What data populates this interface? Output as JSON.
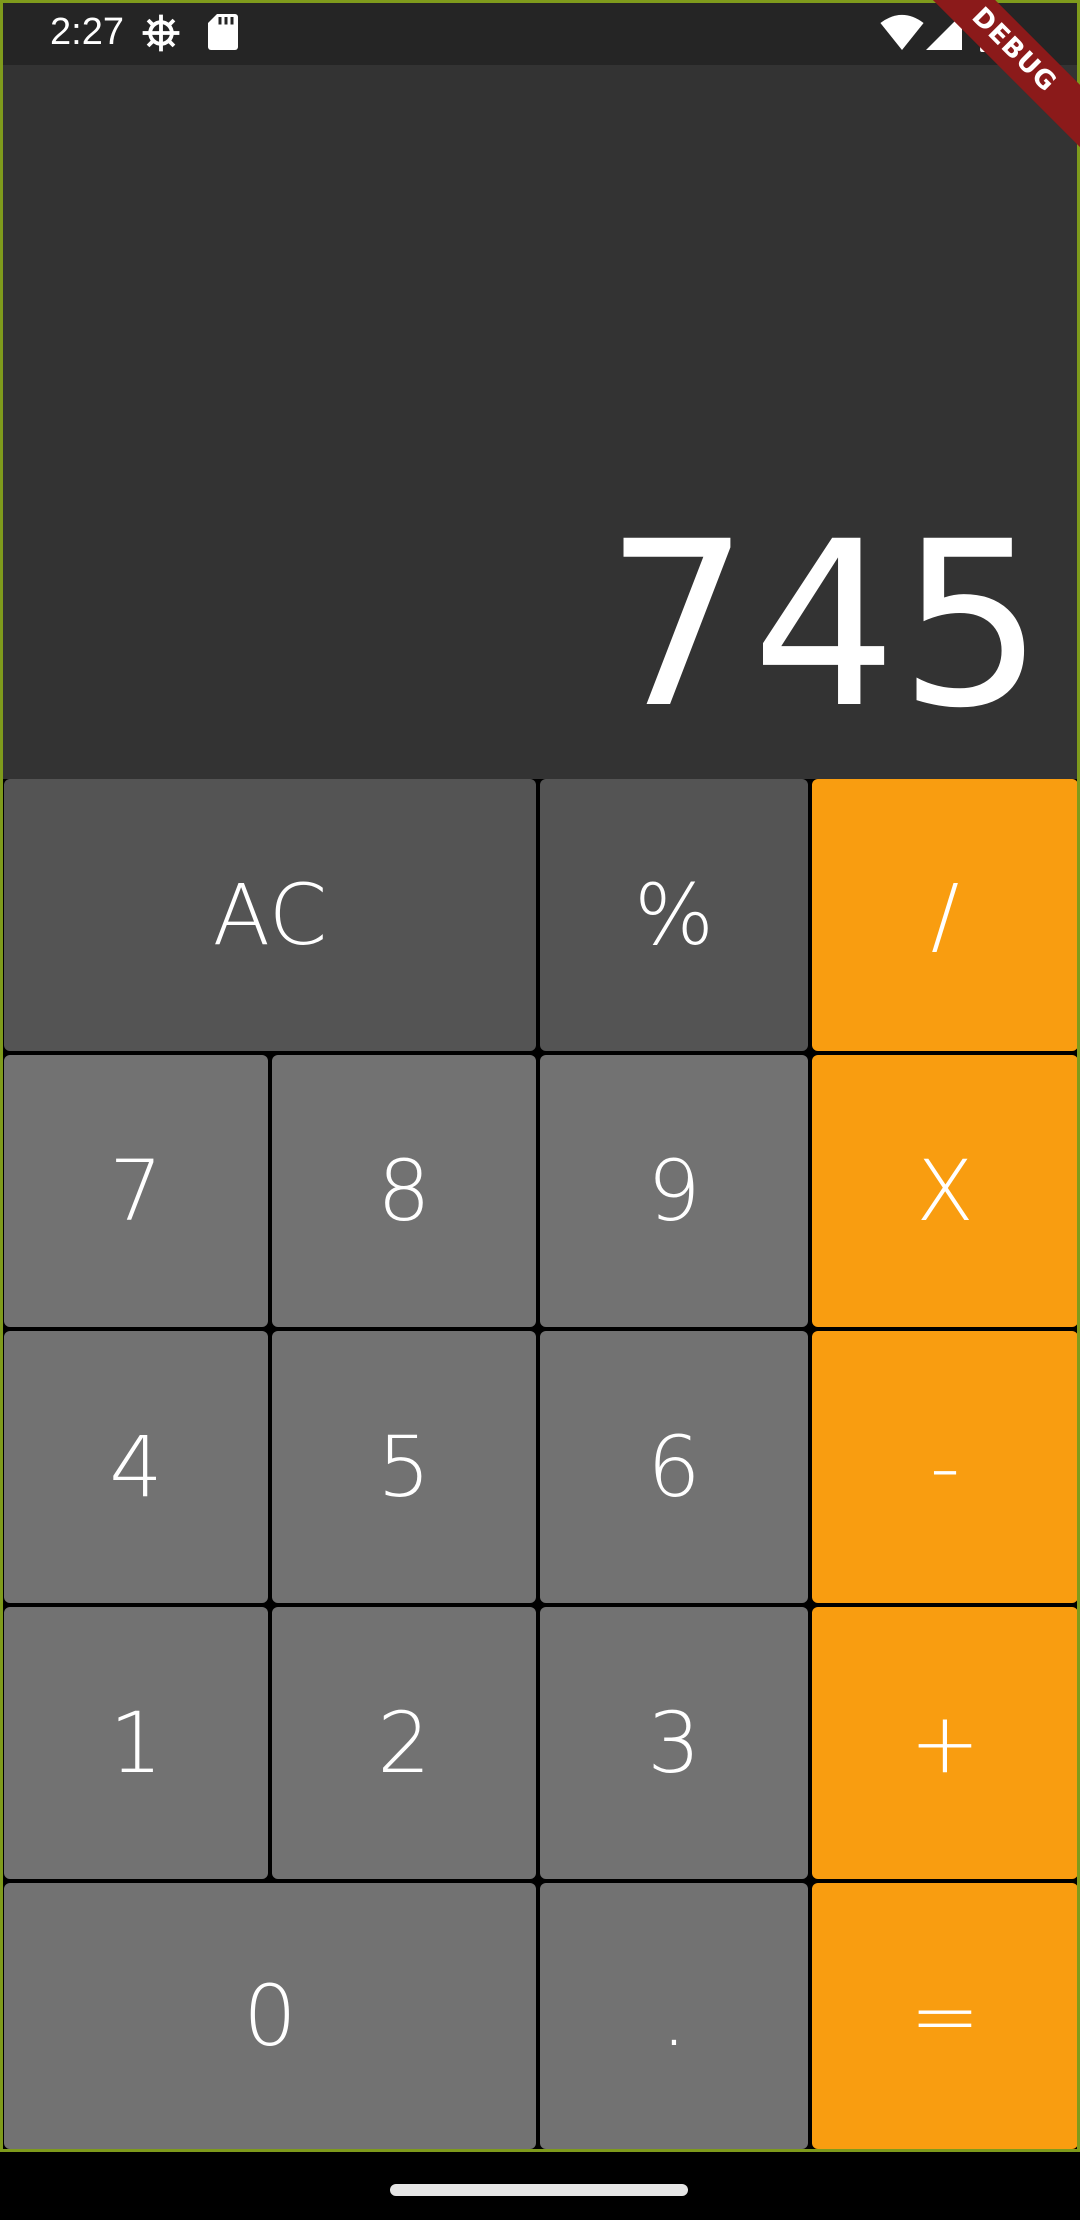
{
  "status_bar": {
    "time": "2:27",
    "left_icons": [
      "gear-icon",
      "sd-card-icon"
    ],
    "right_icons": [
      "wifi-icon",
      "signal-icon",
      "battery-icon"
    ]
  },
  "debug_banner": "DEBUG",
  "display": {
    "value": "745"
  },
  "colors": {
    "display_background": "#333333",
    "function_key": "#545454",
    "number_key": "#727272",
    "operator_key": "#f99d10",
    "text": "#ffffff"
  },
  "keypad": {
    "rows": [
      [
        {
          "label": "AC",
          "kind": "func",
          "name": "clear-button"
        },
        {
          "label": "%",
          "kind": "func",
          "name": "percent-button"
        },
        {
          "label": "/",
          "kind": "op",
          "name": "divide-button"
        }
      ],
      [
        {
          "label": "7",
          "kind": "num",
          "name": "digit-7-button"
        },
        {
          "label": "8",
          "kind": "num",
          "name": "digit-8-button"
        },
        {
          "label": "9",
          "kind": "num",
          "name": "digit-9-button"
        },
        {
          "label": "X",
          "kind": "op",
          "name": "multiply-button"
        }
      ],
      [
        {
          "label": "4",
          "kind": "num",
          "name": "digit-4-button"
        },
        {
          "label": "5",
          "kind": "num",
          "name": "digit-5-button"
        },
        {
          "label": "6",
          "kind": "num",
          "name": "digit-6-button"
        },
        {
          "label": "-",
          "kind": "op",
          "name": "subtract-button"
        }
      ],
      [
        {
          "label": "1",
          "kind": "num",
          "name": "digit-1-button"
        },
        {
          "label": "2",
          "kind": "num",
          "name": "digit-2-button"
        },
        {
          "label": "3",
          "kind": "num",
          "name": "digit-3-button"
        },
        {
          "label": "+",
          "kind": "op",
          "name": "add-button"
        }
      ],
      [
        {
          "label": "0",
          "kind": "num",
          "name": "digit-0-button"
        },
        {
          "label": ".",
          "kind": "num",
          "name": "decimal-button"
        },
        {
          "label": "=",
          "kind": "op",
          "name": "equals-button"
        }
      ]
    ]
  }
}
